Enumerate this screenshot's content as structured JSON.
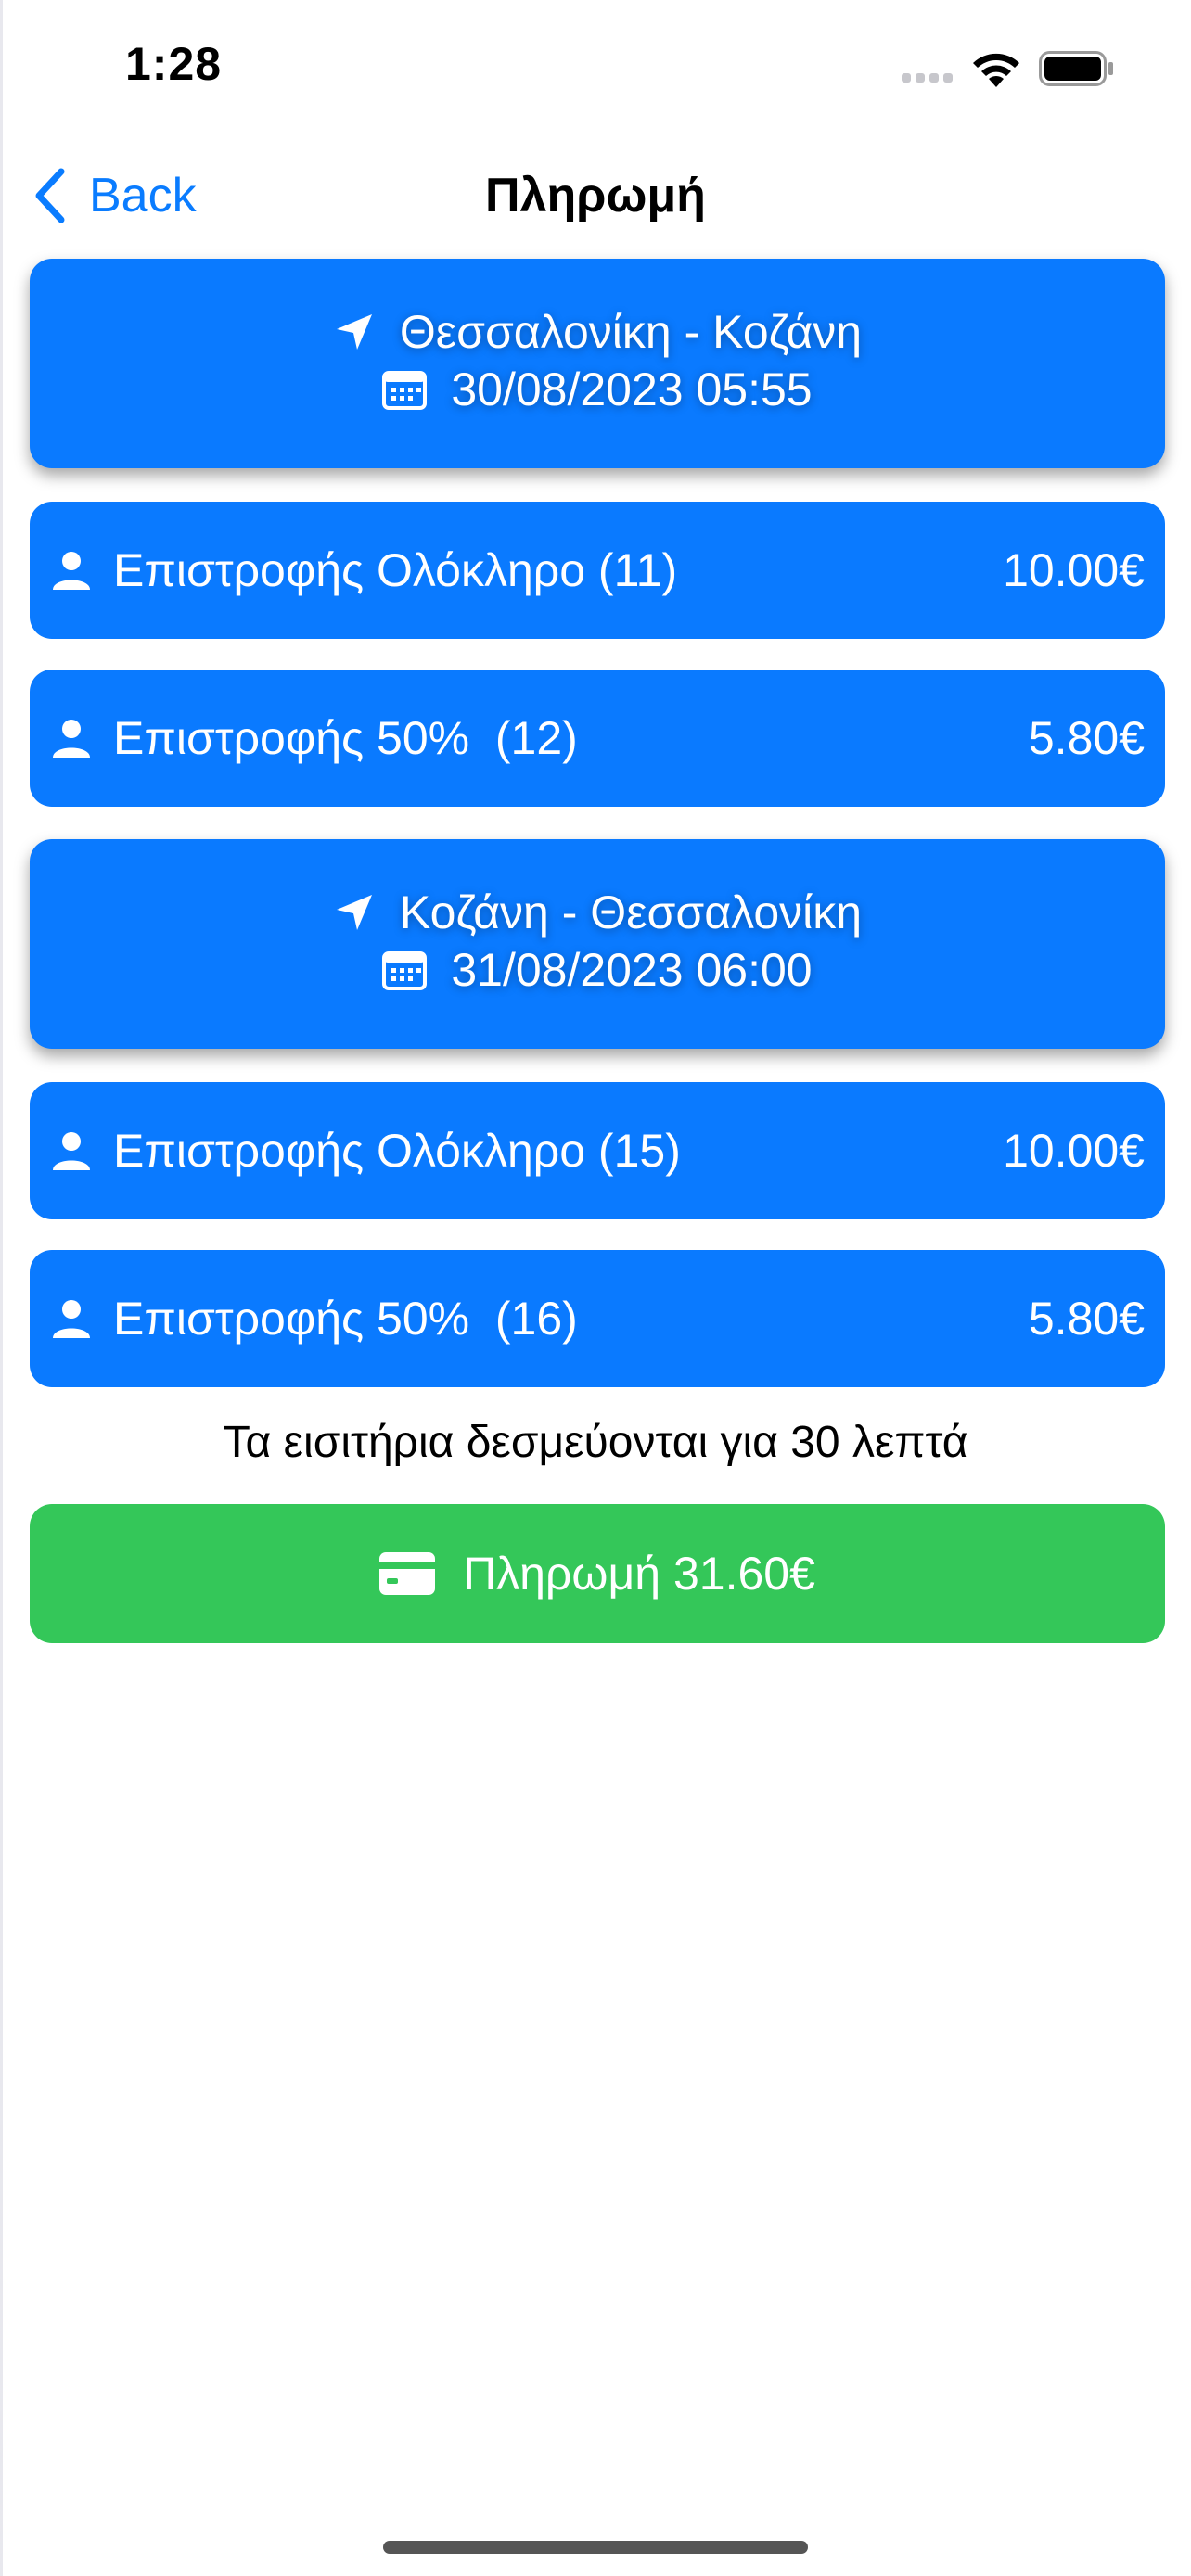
{
  "status_bar": {
    "time": "1:28"
  },
  "nav": {
    "back_label": "Back",
    "title": "Πληρωμή"
  },
  "trips": [
    {
      "route": "Θεσσαλονίκη - Κοζάνη",
      "datetime": "30/08/2023 05:55",
      "tickets": [
        {
          "label": "Επιστροφής Ολόκληρο (11)",
          "price": "10.00€"
        },
        {
          "label": "Επιστροφής 50%  (12)",
          "price": "5.80€"
        }
      ]
    },
    {
      "route": "Κοζάνη - Θεσσαλονίκη",
      "datetime": "31/08/2023 06:00",
      "tickets": [
        {
          "label": "Επιστροφής Ολόκληρο (15)",
          "price": "10.00€"
        },
        {
          "label": "Επιστροφής 50%  (16)",
          "price": "5.80€"
        }
      ]
    }
  ],
  "notice": "Τα εισιτήρια δεσμεύονται για 30 λεπτά",
  "pay_button": {
    "label": "Πληρωμή 31.60€"
  },
  "icons": {
    "back": "chevron-left-icon",
    "route": "location-arrow-icon",
    "date": "calendar-icon",
    "passenger": "person-icon",
    "payment": "credit-card-icon"
  },
  "colors": {
    "accent_blue": "#0a7aff",
    "link_blue": "#0a7cff",
    "pay_green": "#34c759"
  }
}
